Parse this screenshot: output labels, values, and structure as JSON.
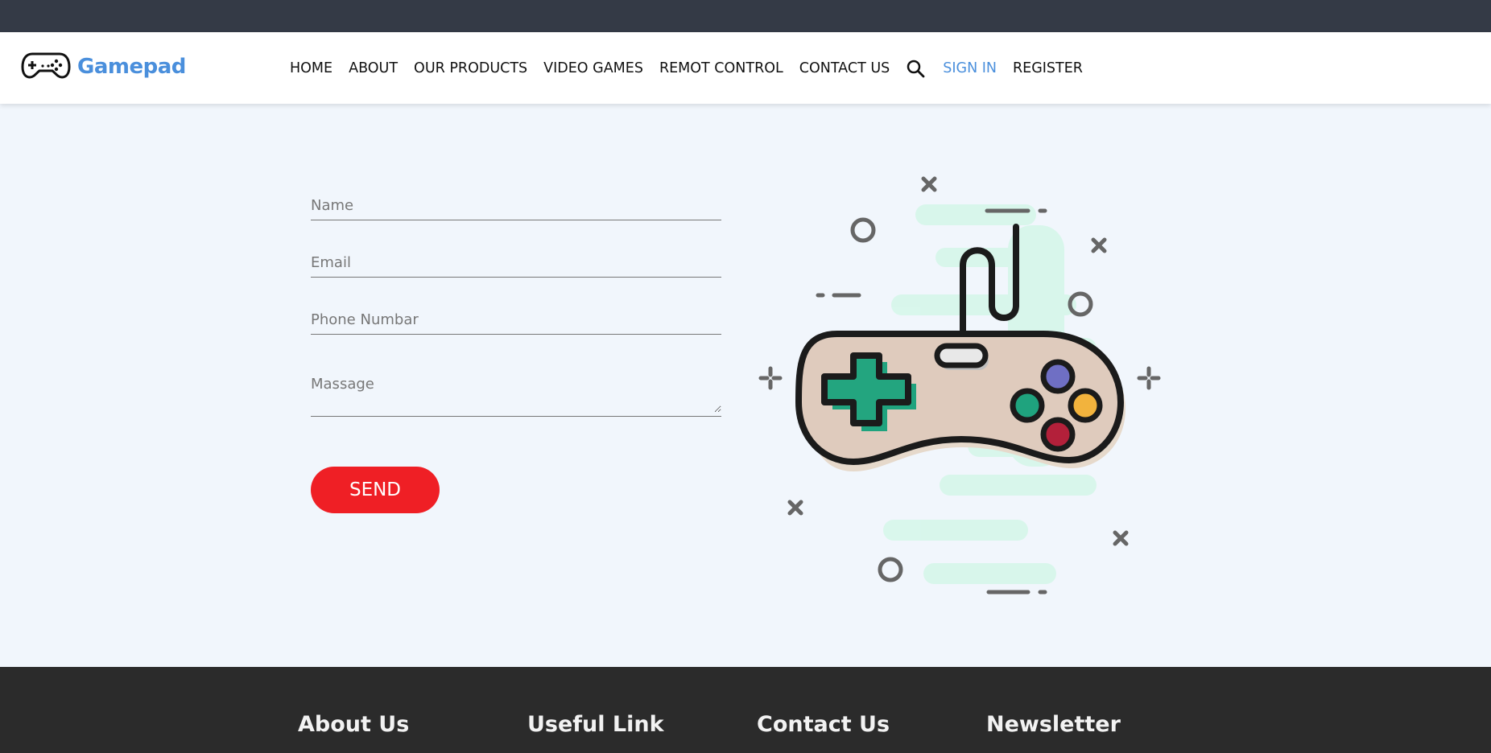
{
  "colors": {
    "accent": "#4a8fdc",
    "send_button": "#ef1f25",
    "top_bar": "#343a46",
    "footer": "#2b2b2b",
    "page_bg": "#f1f6fc"
  },
  "brand": {
    "name": "Gamepad",
    "icon": "gamepad-icon"
  },
  "nav": {
    "items": [
      "HOME",
      "ABOUT",
      "OUR PRODUCTS",
      "VIDEO GAMES",
      "REMOT CONTROL",
      "CONTACT US"
    ],
    "search_icon": "search-icon",
    "sign_in": "SIGN IN",
    "register": "REGISTER"
  },
  "form": {
    "name_placeholder": "Name",
    "email_placeholder": "Email",
    "phone_placeholder": "Phone Numbar",
    "message_placeholder": "Massage",
    "send_label": "SEND"
  },
  "illustration": {
    "icon": "game-controller-illustration"
  },
  "footer": {
    "about_title": "About Us",
    "useful_title": "Useful Link",
    "contact_title": "Contact Us",
    "newsletter_title": "Newsletter"
  }
}
